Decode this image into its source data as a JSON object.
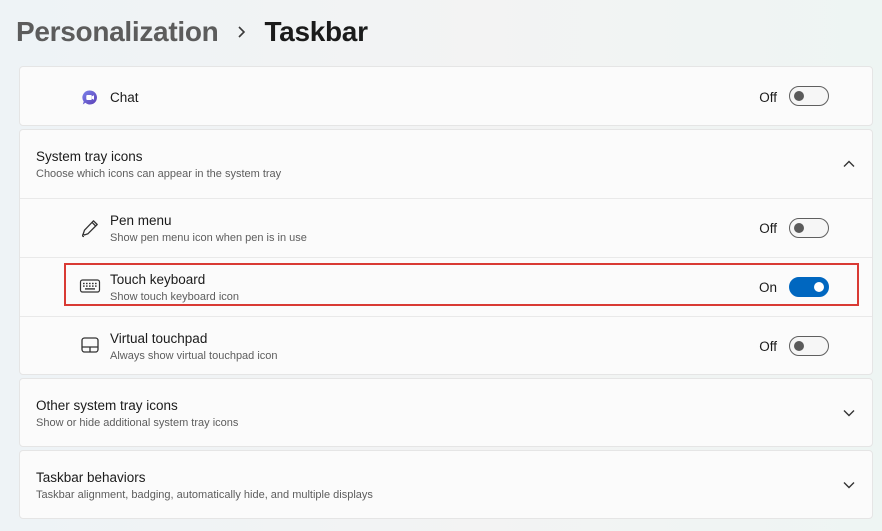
{
  "breadcrumb": {
    "parent": "Personalization",
    "current": "Taskbar"
  },
  "chat": {
    "label": "Chat",
    "state": "Off",
    "enabled": false,
    "icon": "chat-icon"
  },
  "system_tray": {
    "title": "System tray icons",
    "subtitle": "Choose which icons can appear in the system tray",
    "expanded": true,
    "items": [
      {
        "label": "Pen menu",
        "description": "Show pen menu icon when pen is in use",
        "state": "Off",
        "enabled": false,
        "icon": "pen-icon"
      },
      {
        "label": "Touch keyboard",
        "description": "Show touch keyboard icon",
        "state": "On",
        "enabled": true,
        "icon": "keyboard-icon"
      },
      {
        "label": "Virtual touchpad",
        "description": "Always show virtual touchpad icon",
        "state": "Off",
        "enabled": false,
        "icon": "touchpad-icon"
      }
    ]
  },
  "other_tray": {
    "title": "Other system tray icons",
    "subtitle": "Show or hide additional system tray icons"
  },
  "behaviors": {
    "title": "Taskbar behaviors",
    "subtitle": "Taskbar alignment, badging, automatically hide, and multiple displays"
  },
  "colors": {
    "accent": "#0067c0",
    "highlight_border": "#d93a34"
  }
}
